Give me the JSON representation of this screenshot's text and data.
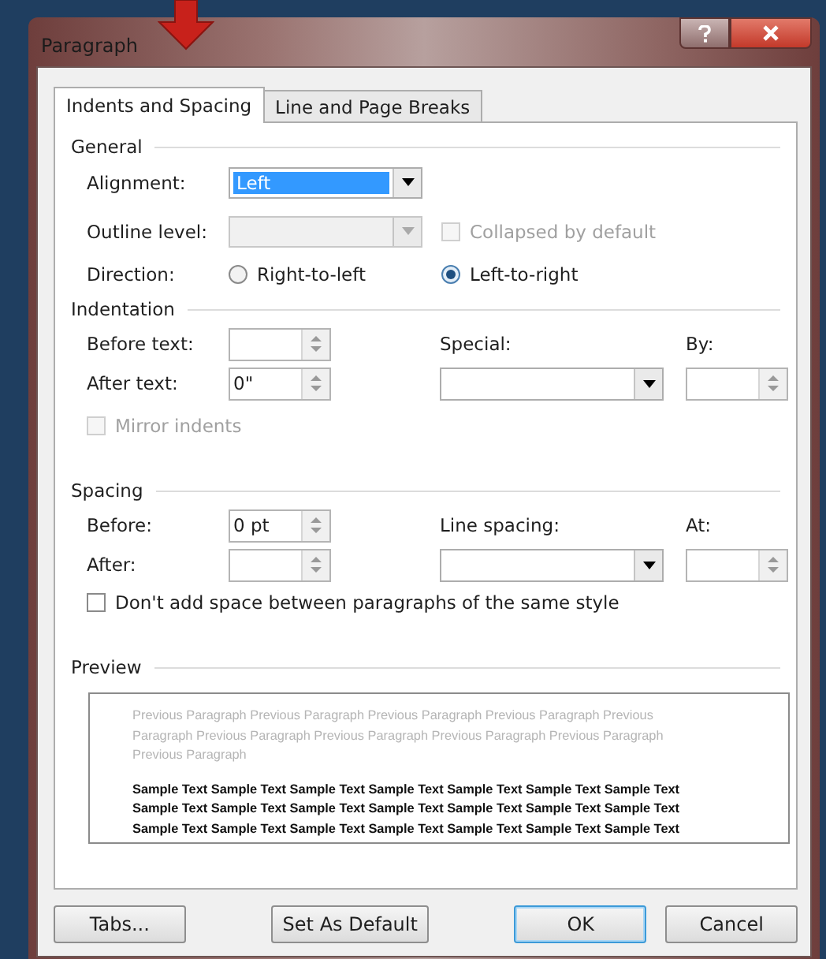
{
  "window": {
    "title": "Paragraph"
  },
  "tabs": [
    {
      "label": "Indents and Spacing",
      "selected": true
    },
    {
      "label": "Line and Page Breaks",
      "selected": false
    }
  ],
  "general": {
    "heading": "General",
    "alignment": {
      "label": "Alignment:",
      "value": "Left",
      "disabled": false
    },
    "outline_level": {
      "label": "Outline level:",
      "disabled": true
    },
    "collapsed": {
      "label": "Collapsed by default",
      "checked": false,
      "disabled": true
    },
    "direction": {
      "label": "Direction:",
      "options": [
        {
          "label": "Right-to-left",
          "selected": false
        },
        {
          "label": "Left-to-right",
          "selected": true
        }
      ]
    }
  },
  "indentation": {
    "heading": "Indentation",
    "before_text": {
      "label": "Before text:"
    },
    "after_text": {
      "label": "After text:",
      "value": "0\""
    },
    "special": {
      "label": "Special:"
    },
    "by": {
      "label": "By:"
    },
    "mirror": {
      "label": "Mirror indents",
      "checked": false,
      "disabled": true
    }
  },
  "spacing": {
    "heading": "Spacing",
    "before": {
      "label": "Before:",
      "value": "0 pt"
    },
    "after": {
      "label": "After:"
    },
    "line_spacing": {
      "label": "Line spacing:"
    },
    "at": {
      "label": "At:"
    },
    "no_space": {
      "label": "Don't add space between paragraphs of the same style",
      "checked": false,
      "disabled": false
    }
  },
  "preview": {
    "heading": "Preview",
    "previous_lines": [
      "Previous Paragraph Previous Paragraph Previous Paragraph Previous Paragraph Previous",
      "Paragraph Previous Paragraph Previous Paragraph Previous Paragraph Previous Paragraph",
      "Previous Paragraph"
    ],
    "sample_lines": [
      "Sample Text Sample Text Sample Text Sample Text Sample Text Sample Text Sample Text",
      "Sample Text Sample Text Sample Text Sample Text Sample Text Sample Text Sample Text",
      "Sample Text Sample Text Sample Text Sample Text Sample Text Sample Text Sample Text"
    ]
  },
  "buttons": [
    {
      "label": "Tabs...",
      "default": false
    },
    {
      "label": "Set As Default",
      "default": false
    },
    {
      "label": "OK",
      "default": true
    },
    {
      "label": "Cancel",
      "default": false
    }
  ]
}
